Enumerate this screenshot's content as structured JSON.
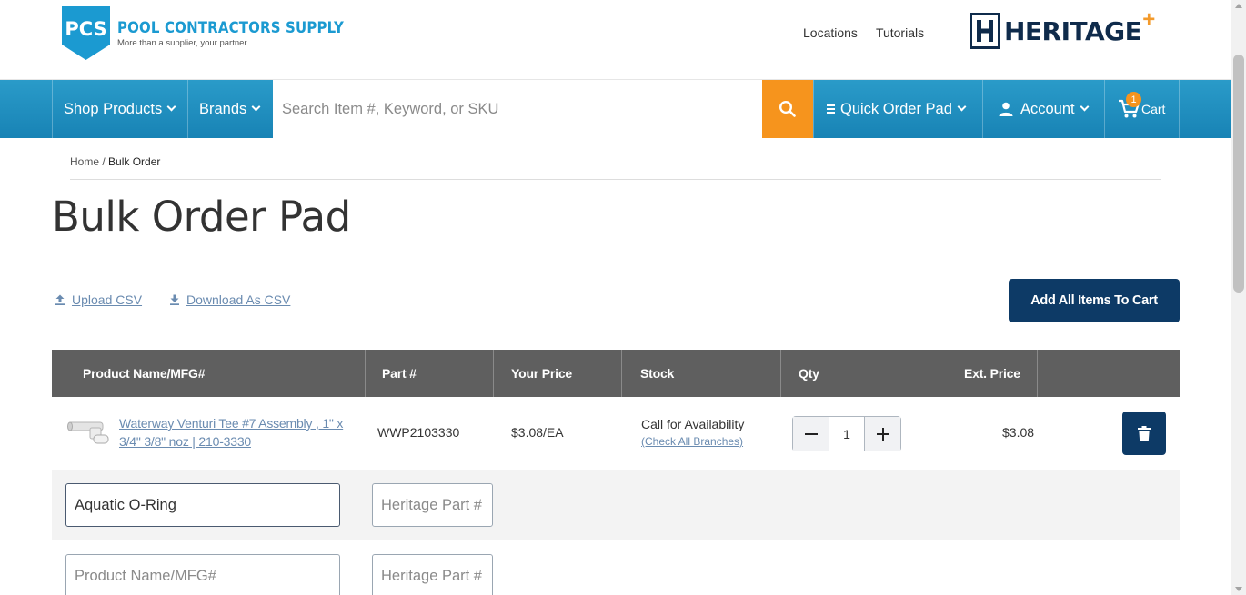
{
  "header": {
    "logo_badge": "PCS",
    "logo_name": "POOL CONTRACTORS SUPPLY",
    "logo_tagline": "More than a supplier, your partner.",
    "links": [
      "Locations",
      "Tutorials"
    ],
    "partner_logo_text": "HERITAGE",
    "partner_logo_plus": "+"
  },
  "nav": {
    "shop_products": "Shop Products",
    "brands": "Brands",
    "search_placeholder": "Search Item #, Keyword, or SKU",
    "search_value": "",
    "quick_order": "Quick Order Pad",
    "account": "Account",
    "cart": "Cart",
    "cart_count": "1"
  },
  "breadcrumb": {
    "home": "Home",
    "separator": " / ",
    "current": "Bulk Order"
  },
  "page_title": "Bulk Order Pad",
  "actions": {
    "upload_csv": "Upload CSV",
    "download_csv": "Download As CSV",
    "add_all": "Add All Items To Cart"
  },
  "table": {
    "headers": {
      "product": "Product Name/MFG#",
      "part": "Part #",
      "price": "Your Price",
      "stock": "Stock",
      "qty": "Qty",
      "ext": "Ext. Price"
    },
    "items": [
      {
        "name": "Waterway Venturi Tee #7 Assembly , 1\" x 3/4\" 3/8\" noz | 210-3330",
        "part": "WWP2103330",
        "price": "$3.08/EA",
        "stock": "Call for Availability",
        "stock_link": "(Check All Branches)",
        "qty": "1",
        "ext_price": "$3.08"
      }
    ],
    "entry_rows": [
      {
        "product_value": "Aquatic O-Ring",
        "product_placeholder": "Product Name/MFG#",
        "part_placeholder": "Heritage Part #"
      },
      {
        "product_value": "",
        "product_placeholder": "Product Name/MFG#",
        "part_placeholder": "Heritage Part #"
      }
    ]
  },
  "colors": {
    "nav_blue": "#1f8fc0",
    "search_orange": "#f6941d",
    "navy": "#0d3a66",
    "table_header": "#5f5f5f",
    "link": "#6a8bb0"
  },
  "icons": [
    "search-icon",
    "menu-dots-icon",
    "user-icon",
    "cart-icon",
    "upload-icon",
    "download-icon",
    "minus-icon",
    "plus-icon",
    "trash-icon",
    "chevron-down-icon"
  ]
}
